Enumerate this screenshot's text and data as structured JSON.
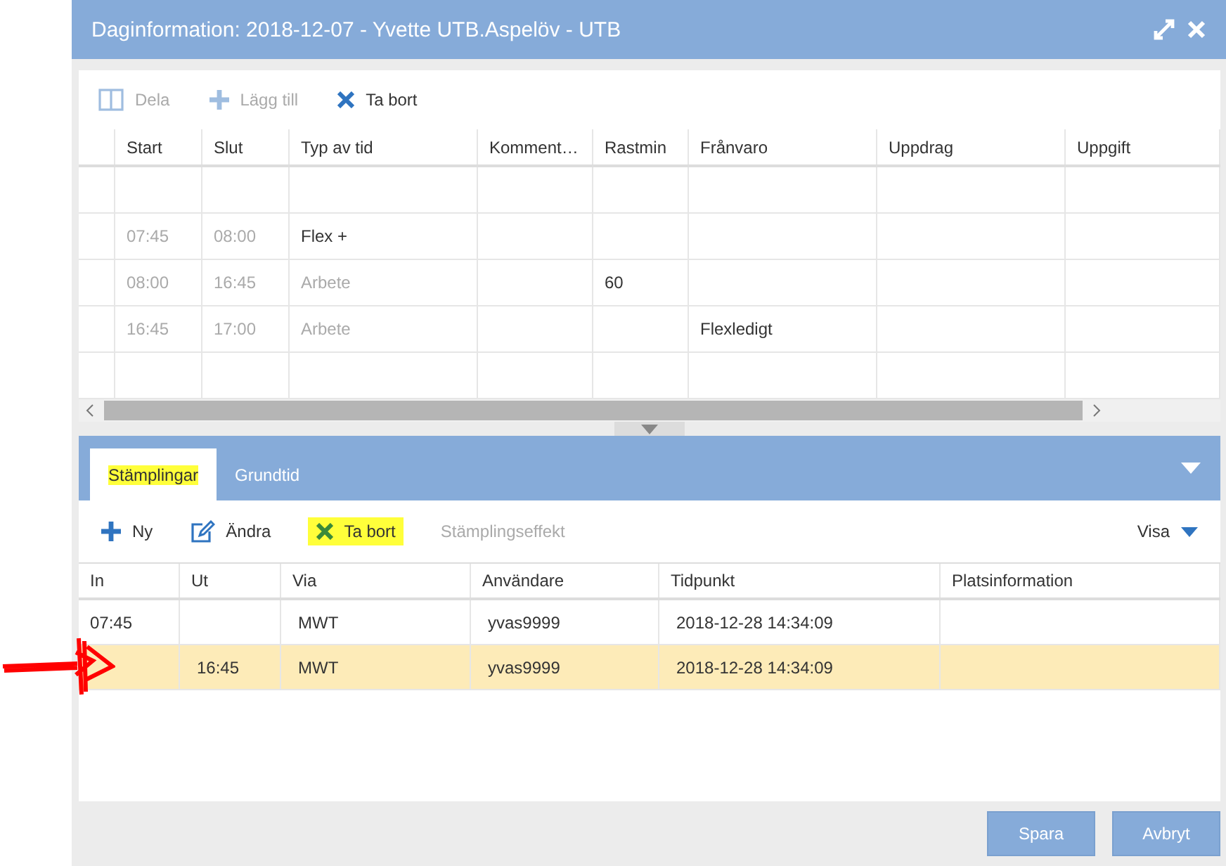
{
  "window": {
    "title": "Daginformation: 2018-12-07 - Yvette UTB.Aspelöv - UTB"
  },
  "day_toolbar": [
    {
      "kind": "split",
      "label": "Dela",
      "disabled": true
    },
    {
      "kind": "add",
      "label": "Lägg till",
      "disabled": true
    },
    {
      "kind": "delete",
      "label": "Ta bort",
      "disabled": false
    }
  ],
  "day_table": {
    "columns": [
      "Start",
      "Slut",
      "Typ av tid",
      "Komment…",
      "Rastmin",
      "Frånvaro",
      "Uppdrag",
      "Uppgift"
    ],
    "rows": [
      {
        "cells": [
          {
            "text": "07:45",
            "muted": true
          },
          {
            "text": "08:00",
            "muted": true
          },
          {
            "text": "Flex +",
            "muted": false
          },
          null,
          null,
          null,
          null,
          null
        ]
      },
      {
        "cells": [
          {
            "text": "08:00",
            "muted": true
          },
          {
            "text": "16:45",
            "muted": true
          },
          {
            "text": "Arbete",
            "muted": true
          },
          null,
          {
            "text": "60",
            "muted": false
          },
          null,
          null,
          null
        ]
      },
      {
        "cells": [
          {
            "text": "16:45",
            "muted": true
          },
          {
            "text": "17:00",
            "muted": true
          },
          {
            "text": "Arbete",
            "muted": true
          },
          null,
          null,
          {
            "text": "Flexledigt",
            "muted": false
          },
          null,
          null
        ]
      }
    ]
  },
  "tabs": [
    {
      "label": "Stämplingar",
      "selected": true,
      "highlighted": true
    },
    {
      "label": "Grundtid",
      "selected": false,
      "highlighted": false
    }
  ],
  "stamp_toolbar": [
    {
      "kind": "add",
      "label": "Ny",
      "disabled": false,
      "highlighted": false
    },
    {
      "kind": "edit",
      "label": "Ändra",
      "disabled": false,
      "highlighted": false
    },
    {
      "kind": "delete",
      "label": "Ta bort",
      "disabled": false,
      "highlighted": true
    },
    {
      "kind": "text",
      "label": "Stämplingseffekt",
      "disabled": true,
      "highlighted": false
    }
  ],
  "view_menu": {
    "label": "Visa"
  },
  "stamp_table": {
    "columns": [
      "In",
      "Ut",
      "Via",
      "Användare",
      "Tidpunkt",
      "Platsinformation"
    ],
    "rows": [
      {
        "selected": false,
        "cells": [
          "07:45",
          null,
          "MWT",
          "yvas9999",
          "2018-12-28 14:34:09",
          null
        ]
      },
      {
        "selected": true,
        "cells": [
          null,
          "16:45",
          "MWT",
          "yvas9999",
          "2018-12-28 14:34:09",
          null
        ]
      }
    ]
  },
  "buttons": [
    "Spara",
    "Avbryt"
  ]
}
